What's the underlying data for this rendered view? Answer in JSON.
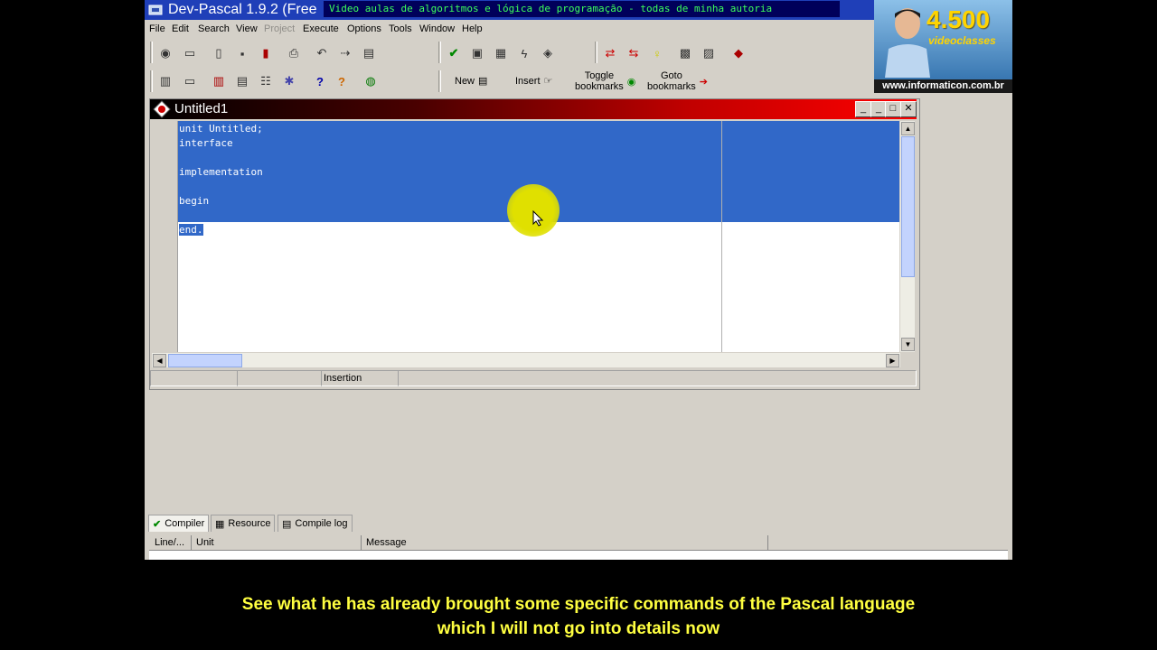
{
  "app": {
    "title": "Dev-Pascal 1.9.2 (Free",
    "overlay_banner": "Video aulas de algoritmos e lógica de programação - todas de minha autoria"
  },
  "promo": {
    "count": "4.500",
    "subtitle": "videoclasses",
    "url": "www.informaticon.com.br"
  },
  "menu": [
    {
      "label": "File",
      "enabled": true
    },
    {
      "label": "Edit",
      "enabled": true
    },
    {
      "label": "Search",
      "enabled": true
    },
    {
      "label": "View",
      "enabled": true
    },
    {
      "label": "Project",
      "enabled": false
    },
    {
      "label": "Execute",
      "enabled": true
    },
    {
      "label": "Options",
      "enabled": true
    },
    {
      "label": "Tools",
      "enabled": true
    },
    {
      "label": "Window",
      "enabled": true
    },
    {
      "label": "Help",
      "enabled": true
    }
  ],
  "toolbar": {
    "new_label": "New",
    "insert_label": "Insert",
    "toggle_bookmarks_label_1": "Toggle",
    "toggle_bookmarks_label_2": "bookmarks",
    "goto_bookmarks_label_1": "Goto",
    "goto_bookmarks_label_2": "bookmarks"
  },
  "editor": {
    "title": "Untitled1",
    "lines": [
      "unit Untitled;",
      "interface",
      "",
      "implementation",
      "",
      "begin",
      "",
      "end."
    ],
    "status_mode": "Insertion"
  },
  "bottom_panel": {
    "tabs": [
      "Compiler",
      "Resource",
      "Compile log"
    ],
    "columns": [
      "Line/...",
      "Unit",
      "Message"
    ]
  },
  "subtitle": {
    "line1": "See what he has already brought some specific commands of the Pascal language",
    "line2": "which I will not go into details now"
  },
  "colors": {
    "selection": "#3168c8",
    "titlebar": "#1f3fb8",
    "overlay_text": "#3cff5a",
    "subtitle": "#ffff40",
    "cursor_highlight": "#e0e000"
  }
}
